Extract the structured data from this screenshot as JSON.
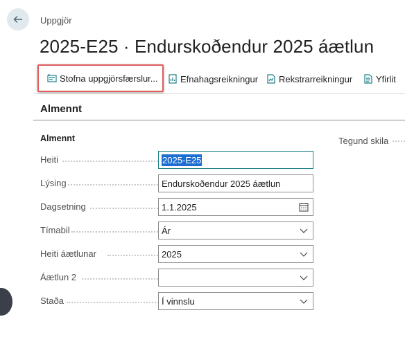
{
  "breadcrumb": "Uppgjör",
  "page_title": "2025-E25 · Endurskoðendur 2025 áætlun",
  "actions": [
    {
      "label": "Stofna uppgjörsfærslur...",
      "icon": "create-entries-icon"
    },
    {
      "label": "Efnahagsreikningur",
      "icon": "balance-sheet-icon"
    },
    {
      "label": "Rekstrarreikningur",
      "icon": "income-statement-icon"
    },
    {
      "label": "Yfirlit",
      "icon": "overview-icon"
    }
  ],
  "section_title": "Almennt",
  "group_title": "Almennt",
  "right_label": "Tegund skila",
  "fields": [
    {
      "label": "Heiti",
      "value": "2025-E25",
      "type": "text"
    },
    {
      "label": "Lýsing",
      "value": "Endurskoðendur 2025 áætlun",
      "type": "text"
    },
    {
      "label": "Dagsetning",
      "value": "1.1.2025",
      "type": "date"
    },
    {
      "label": "Tímabil",
      "value": "Ár",
      "type": "select"
    },
    {
      "label": "Heiti áætlunar",
      "value": "2025",
      "type": "select"
    },
    {
      "label": "Áætlun 2",
      "value": "",
      "type": "select"
    },
    {
      "label": "Staða",
      "value": "Í vinnslu",
      "type": "select"
    }
  ],
  "colors": {
    "accent": "#1a7f88",
    "highlight_border": "#e05c5c",
    "selection": "#1d6ed1"
  }
}
